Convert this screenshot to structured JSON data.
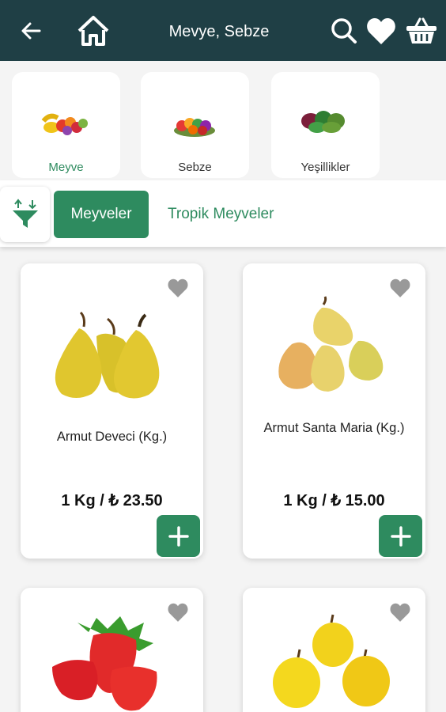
{
  "header": {
    "title": "Mevye, Sebze",
    "icons": [
      "back-arrow-icon",
      "home-icon",
      "search-icon",
      "heart-icon",
      "basket-icon"
    ]
  },
  "categories": [
    {
      "label": "Meyve",
      "active": true,
      "icon": "fruit-icon"
    },
    {
      "label": "Sebze",
      "active": false,
      "icon": "vegetable-icon"
    },
    {
      "label": "Yeşillikler",
      "active": false,
      "icon": "greens-icon"
    }
  ],
  "subtabs": {
    "active": "Meyveler",
    "other": "Tropik Meyveler"
  },
  "products": [
    {
      "name": "Armut Deveci (Kg.)",
      "price": "1 Kg / ₺ 23.50",
      "image": "pear-icon"
    },
    {
      "name": "Armut Santa Maria (Kg.)",
      "price": "1 Kg / ₺ 15.00",
      "image": "pear-icon"
    },
    {
      "name": "",
      "price": "",
      "image": "strawberry-icon"
    },
    {
      "name": "",
      "price": "",
      "image": "apple-icon"
    }
  ],
  "colors": {
    "header_bg": "#1f3f45",
    "accent": "#2e8b5f",
    "fav_icon": "#999999"
  }
}
